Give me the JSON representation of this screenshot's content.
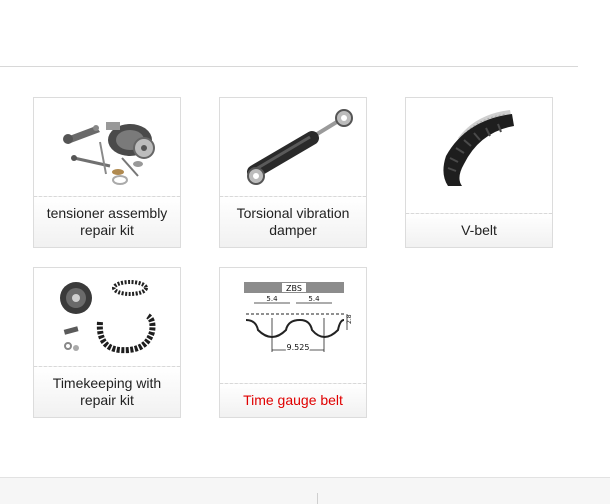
{
  "products": [
    {
      "label": "tensioner assembly repair kit",
      "icon": "tensioner-kit-image",
      "highlight": false
    },
    {
      "label": "Torsional vibration damper",
      "icon": "damper-image",
      "highlight": false
    },
    {
      "label": "V-belt",
      "icon": "v-belt-image",
      "highlight": false
    },
    {
      "label": "Timekeeping with repair kit",
      "icon": "timing-kit-image",
      "highlight": false
    },
    {
      "label": "Time gauge belt",
      "icon": "timing-belt-diagram",
      "highlight": true,
      "diagram": {
        "profile": "ZBS",
        "pitch_left": "5.4",
        "pitch_right": "5.4",
        "depth": "2.8",
        "total": "9.525"
      }
    }
  ],
  "colors": {
    "highlight_text": "#e00000",
    "caption_text": "#222222",
    "border": "#dcdcdc"
  }
}
